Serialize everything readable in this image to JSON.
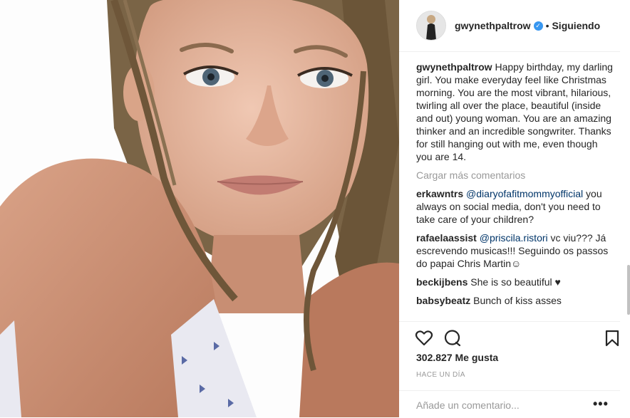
{
  "post": {
    "username": "gwynethpaltrow",
    "verified_icon": "verified-badge-icon",
    "separator": "•",
    "follow_status": "Siguiendo"
  },
  "caption": {
    "username": "gwynethpaltrow",
    "text": "Happy birthday, my darling girl. You make everyday feel like Christmas morning. You are the most vibrant, hilarious, twirling all over the place, beautiful (inside and out) young woman. You are an amazing thinker and an incredible songwriter. Thanks for still hanging out with me, even though you are 14."
  },
  "load_more": "Cargar más comentarios",
  "comments": [
    {
      "user": "erkawntrs",
      "mention": "@diaryofafitmommyofficial",
      "text": " you always on social media, don't you need to take care of your children?"
    },
    {
      "user": "rafaelaassist",
      "mention": "@priscila.ristori",
      "text": " vc viu??? Já escrevendo musicas!!! Seguindo os passos do papai Chris Martin☺"
    },
    {
      "user": "beckijbens",
      "mention": "",
      "text": "She is so beautiful ♥"
    },
    {
      "user": "babsybeatz",
      "mention": "",
      "text": "Bunch of kiss asses"
    }
  ],
  "likes": "302.827 Me gusta",
  "time": "HACE UN DÍA",
  "add_comment_placeholder": "Añade un comentario...",
  "more_options": "•••",
  "colors": {
    "link": "#003569",
    "muted": "#999999",
    "verified": "#3897f0"
  }
}
